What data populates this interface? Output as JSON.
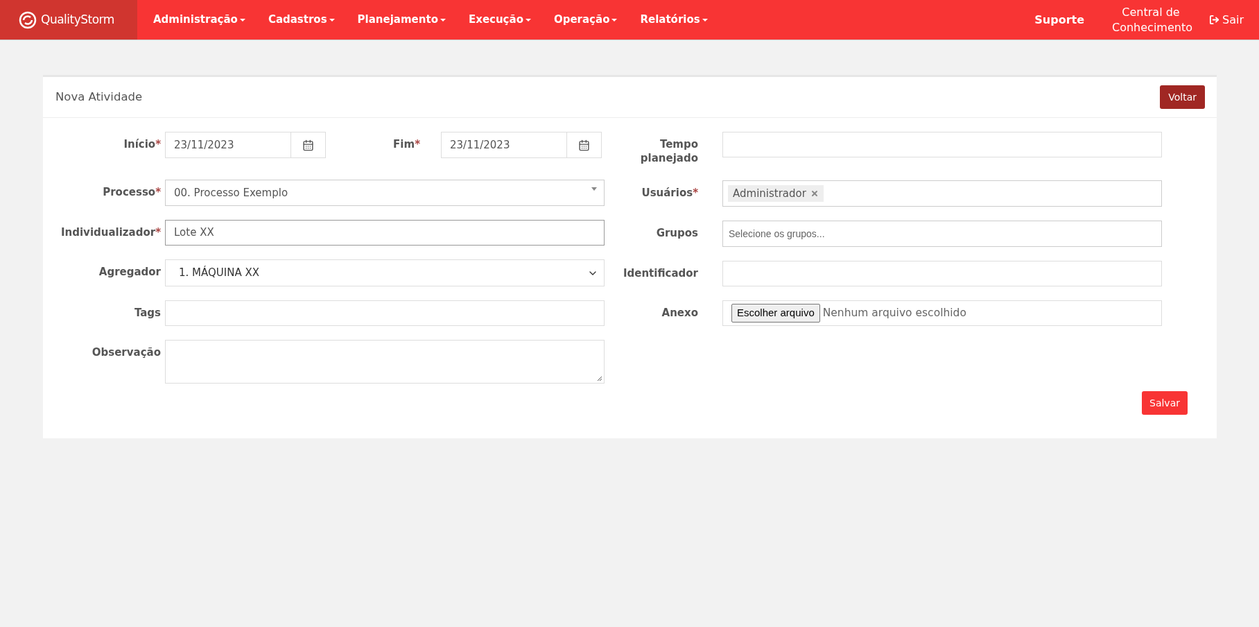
{
  "nav": {
    "brand": "QualityStorm",
    "menus": [
      {
        "label": "Administração"
      },
      {
        "label": "Cadastros"
      },
      {
        "label": "Planejamento"
      },
      {
        "label": "Execução"
      },
      {
        "label": "Operação"
      },
      {
        "label": "Relatórios"
      }
    ],
    "links": [
      {
        "label": "Suporte",
        "kind": "bold"
      },
      {
        "label": "Central de Conhecimento",
        "kind": "wrap"
      },
      {
        "label": "Sair",
        "kind": "logout"
      }
    ]
  },
  "card": {
    "title": "Nova Atividade",
    "back_button": "Voltar",
    "save_button": "Salvar",
    "left_fields": [
      {
        "kind": "date_pair",
        "fields": [
          {
            "label": "Início",
            "mark": "*",
            "value": "23/11/2023"
          },
          {
            "label": "Fim",
            "mark": "*",
            "value": "23/11/2023"
          }
        ]
      },
      {
        "kind": "combo",
        "label": "Processo",
        "mark": "*",
        "value": "00. Processo Exemplo"
      },
      {
        "kind": "text",
        "label": "Individualizador",
        "mark": "*",
        "value": "Lote XX",
        "focused": true
      },
      {
        "kind": "select",
        "label": "Agregador",
        "value": "1. MÁQUINA XX"
      },
      {
        "kind": "text",
        "label": "Tags",
        "focused": false
      },
      {
        "kind": "textarea",
        "label": "Observação"
      }
    ],
    "right_fields": [
      {
        "kind": "text",
        "label": "Tempo planejado",
        "focused": false
      },
      {
        "kind": "chips",
        "label": "Usuários",
        "mark": "*",
        "chips": [
          "Administrador"
        ]
      },
      {
        "kind": "multiselect",
        "label": "Grupos",
        "placeholder": "Selecione os grupos..."
      },
      {
        "kind": "text",
        "label": "Identificador",
        "focused": false
      },
      {
        "kind": "file",
        "label": "Anexo",
        "button": "Escolher arquivo",
        "status": "Nenhum arquivo escolhido"
      }
    ]
  }
}
